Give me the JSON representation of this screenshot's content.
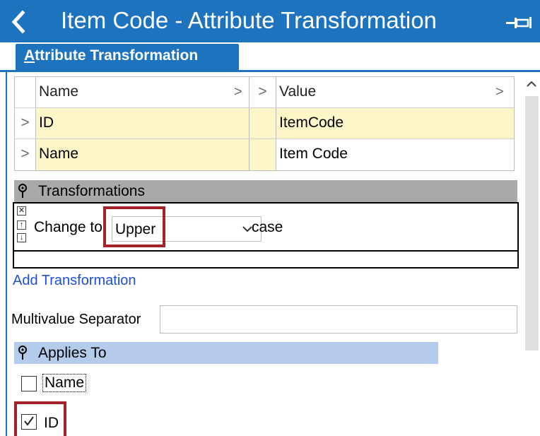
{
  "window": {
    "title": "Item Code - Attribute Transformation",
    "back_icon": "chevron-left-icon",
    "pin_icon": "pin-icon"
  },
  "tabs": [
    {
      "accel": "A",
      "label_rest": "ttribute Transformation",
      "active": true
    }
  ],
  "grid": {
    "headers": {
      "name": "Name",
      "value": "Value",
      "expand_glyph": ">"
    },
    "rows": [
      {
        "expander": ">",
        "name": "ID",
        "value": "ItemCode"
      },
      {
        "expander": ">",
        "name": "Name",
        "value": "Item Code"
      }
    ]
  },
  "transformations": {
    "section_label": "Transformations",
    "items": [
      {
        "prefix": "Change to",
        "case_value": "Upper",
        "suffix": "case"
      }
    ],
    "add_link": "Add Transformation"
  },
  "multivalue": {
    "label": "Multivalue Separator",
    "value": ""
  },
  "applies_to": {
    "section_label": "Applies To",
    "options": [
      {
        "label": "Name",
        "checked": false
      },
      {
        "label": "ID",
        "checked": true
      }
    ]
  },
  "colors": {
    "accent": "#1e73be",
    "highlight_box": "#a3232b",
    "grid_row_bg": "#fdf6c8",
    "applies_header_bg": "#b4cbec",
    "transform_header_bg": "#a9a9a9",
    "link": "#1f4fd6"
  }
}
